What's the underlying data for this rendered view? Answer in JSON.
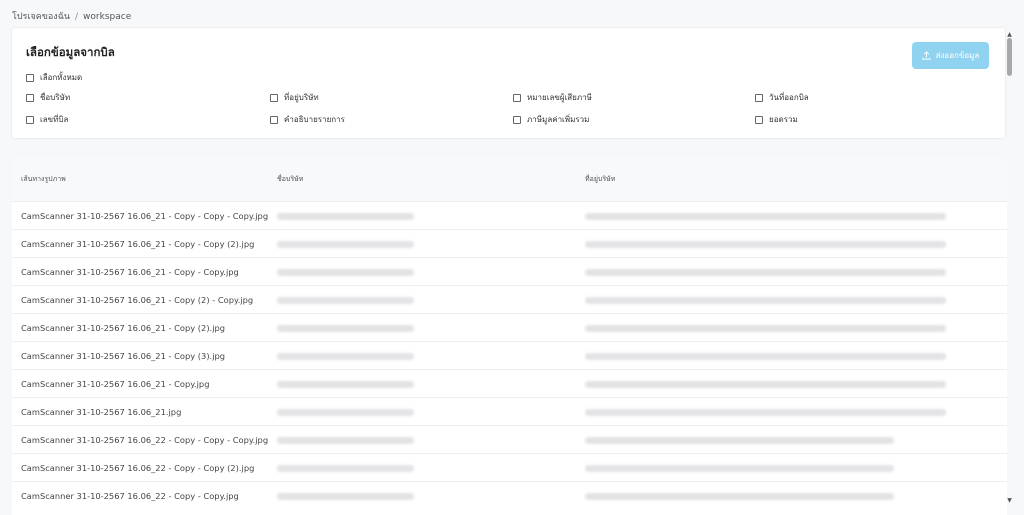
{
  "breadcrumb": {
    "parent": "โปรเจคของฉัน",
    "separator": "/",
    "current": "workspace"
  },
  "select_panel": {
    "title": "เลือกข้อมูลจากบิล",
    "export_label": "ส่งออกข้อมูล",
    "select_all": "เลือกทั้งหมด",
    "fields": [
      "ชื่อบริษัท",
      "ที่อยู่บริษัท",
      "หมายเลขผู้เสียภาษี",
      "วันที่ออกบิล",
      "เลขที่บิล",
      "คำอธิบายรายการ",
      "ภาษีมูลค่าเพิ่มรวม",
      "ยอดรวม"
    ]
  },
  "table": {
    "columns": [
      "เส้นทางรูปภาพ",
      "ชื่อบริษัท",
      "ที่อยู่บริษัท"
    ],
    "rows": [
      "CamScanner 31-10-2567 16.06_21 - Copy - Copy - Copy.jpg",
      "CamScanner 31-10-2567 16.06_21 - Copy - Copy (2).jpg",
      "CamScanner 31-10-2567 16.06_21 - Copy - Copy.jpg",
      "CamScanner 31-10-2567 16.06_21 - Copy (2) - Copy.jpg",
      "CamScanner 31-10-2567 16.06_21 - Copy (2).jpg",
      "CamScanner 31-10-2567 16.06_21 - Copy (3).jpg",
      "CamScanner 31-10-2567 16.06_21 - Copy.jpg",
      "CamScanner 31-10-2567 16.06_21.jpg",
      "CamScanner 31-10-2567 16.06_22 - Copy - Copy - Copy.jpg",
      "CamScanner 31-10-2567 16.06_22 - Copy - Copy (2).jpg",
      "CamScanner 31-10-2567 16.06_22 - Copy - Copy.jpg"
    ]
  },
  "icons": {
    "export": "upload-icon"
  },
  "colors": {
    "accent": "#8fd3f1",
    "page_bg": "#f7f8f9"
  }
}
